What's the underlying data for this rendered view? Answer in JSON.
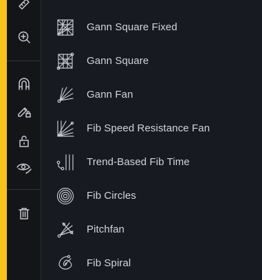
{
  "toolbar": {
    "buttons": [
      {
        "icon": "ruler-icon"
      },
      {
        "icon": "zoom-in-icon"
      },
      {
        "icon": "magnet-icon"
      },
      {
        "icon": "pencil-lock-icon"
      },
      {
        "icon": "unlock-icon"
      },
      {
        "icon": "eye-icon"
      },
      {
        "icon": "trash-icon"
      }
    ]
  },
  "menu": {
    "items": [
      {
        "label": "Gann Square Fixed",
        "icon": "gann-square-fixed-icon"
      },
      {
        "label": "Gann Square",
        "icon": "gann-square-icon"
      },
      {
        "label": "Gann Fan",
        "icon": "gann-fan-icon"
      },
      {
        "label": "Fib Speed Resistance Fan",
        "icon": "fib-speed-resistance-fan-icon"
      },
      {
        "label": "Trend-Based Fib Time",
        "icon": "trend-based-fib-time-icon"
      },
      {
        "label": "Fib Circles",
        "icon": "fib-circles-icon"
      },
      {
        "label": "Pitchfan",
        "icon": "pitchfan-icon"
      },
      {
        "label": "Fib Spiral",
        "icon": "fib-spiral-icon"
      }
    ]
  },
  "colors": {
    "frame": "#f7c21b",
    "panel": "#181a21",
    "toolbar": "#131518",
    "text": "#d3d5da",
    "icon": "#c8cad0"
  }
}
